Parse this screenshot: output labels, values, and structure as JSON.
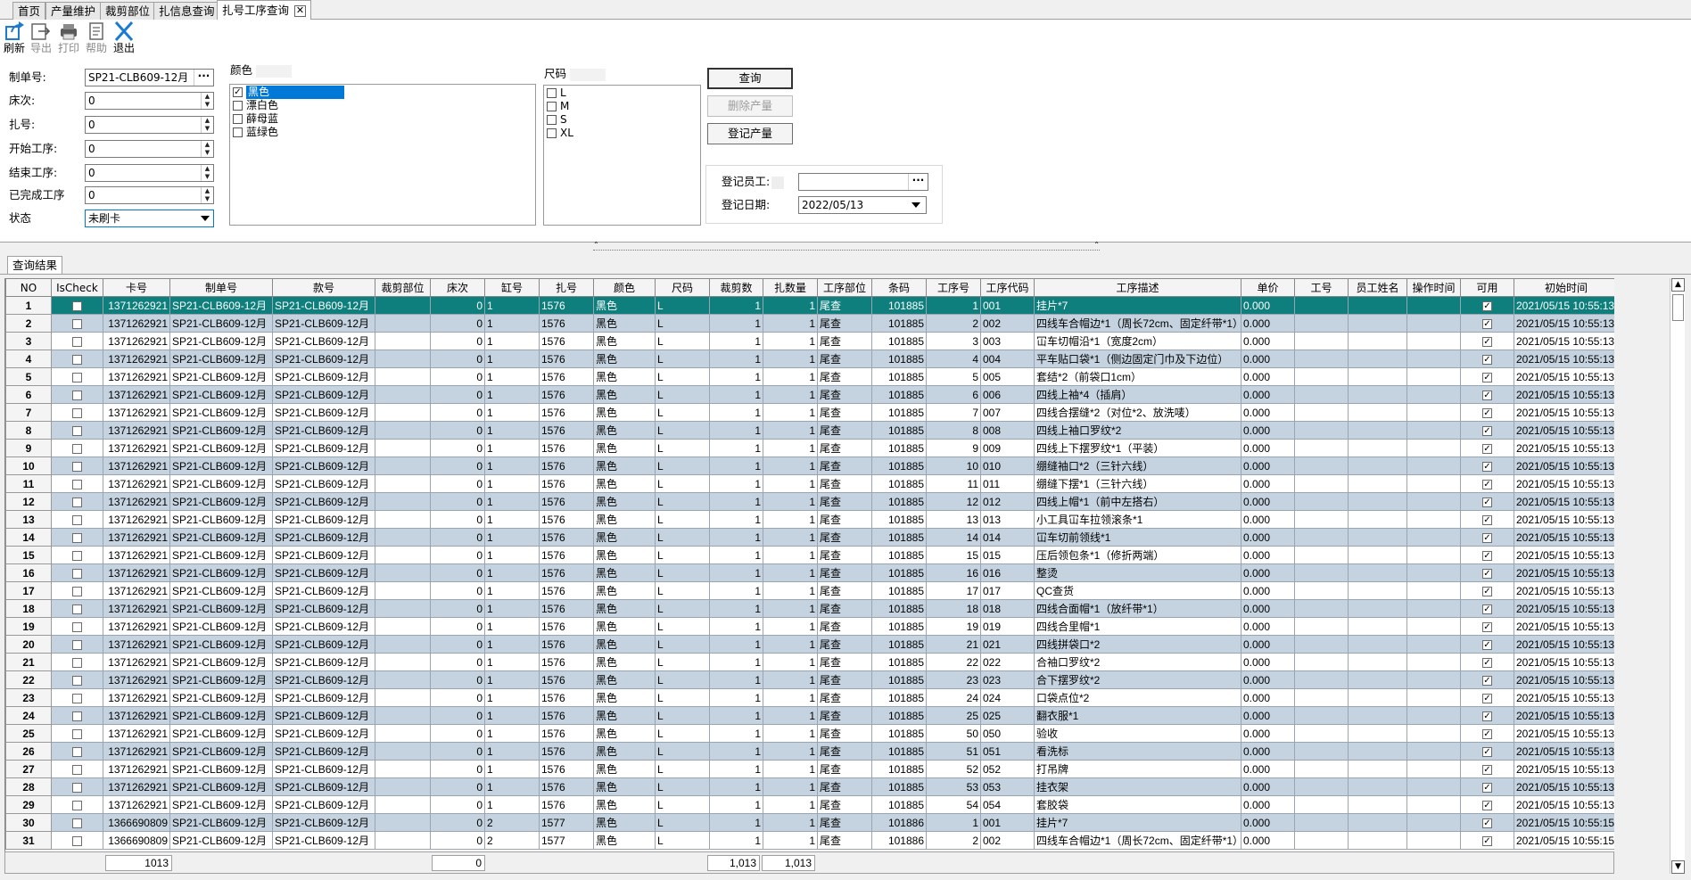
{
  "tabs": [
    {
      "label": "首页",
      "active": false
    },
    {
      "label": "产量维护",
      "active": false
    },
    {
      "label": "裁剪部位",
      "active": false
    },
    {
      "label": "扎信息查询",
      "active": false
    },
    {
      "label": "扎号工序查询",
      "active": true
    }
  ],
  "toolbar": {
    "refresh": "刷新",
    "export": "导出",
    "print": "打印",
    "help": "帮助",
    "exit": "退出"
  },
  "filters": {
    "order_label": "制单号:",
    "order_value": "SP21-CLB609-12月",
    "bed_label": "床次:",
    "bed_value": "0",
    "bundle_label": "扎号:",
    "bundle_value": "0",
    "start_label": "开始工序:",
    "start_value": "0",
    "end_label": "结束工序:",
    "end_value": "0",
    "done_label": "已完成工序",
    "done_value": "0",
    "status_label": "状态",
    "status_value": "未刷卡"
  },
  "color": {
    "label": "颜色",
    "items": [
      {
        "name": "黑色",
        "checked": true,
        "selected": true
      },
      {
        "name": "漂白色",
        "checked": false,
        "selected": false
      },
      {
        "name": "薛母蓝",
        "checked": false,
        "selected": false
      },
      {
        "name": "蓝绿色",
        "checked": false,
        "selected": false
      }
    ]
  },
  "size": {
    "label": "尺码",
    "items": [
      {
        "name": "L",
        "checked": false
      },
      {
        "name": "M",
        "checked": false
      },
      {
        "name": "S",
        "checked": false
      },
      {
        "name": "XL",
        "checked": false
      }
    ]
  },
  "buttons": {
    "query": "查询",
    "delete_output": "删除产量",
    "register_output": "登记产量"
  },
  "register": {
    "employee_label": "登记员工:",
    "employee_value": "",
    "date_label": "登记日期:",
    "date_value": "2022/05/13"
  },
  "result_tab": "查询结果",
  "grid": {
    "columns": [
      "NO",
      "IsCheck",
      "卡号",
      "制单号",
      "款号",
      "裁剪部位",
      "床次",
      "缸号",
      "扎号",
      "颜色",
      "尺码",
      "裁剪数",
      "扎数量",
      "工序部位",
      "条码",
      "工序号",
      "工序代码",
      "工序描述",
      "单价",
      "工号",
      "员工姓名",
      "操作时间",
      "可用",
      "初始时间"
    ],
    "rows": [
      [
        "1",
        "",
        "1371262921",
        "SP21-CLB609-12月",
        "SP21-CLB609-12月",
        "",
        "0",
        "1",
        "1576",
        "黑色",
        "L",
        "1",
        "1",
        "尾查",
        "101885",
        "1",
        "001",
        "挂片*7",
        "0.000",
        "",
        "",
        "",
        "✓",
        "2021/05/15 10:55:13"
      ],
      [
        "2",
        "",
        "1371262921",
        "SP21-CLB609-12月",
        "SP21-CLB609-12月",
        "",
        "0",
        "1",
        "1576",
        "黑色",
        "L",
        "1",
        "1",
        "尾查",
        "101885",
        "2",
        "002",
        "四线车合帽边*1（周长72cm、固定纤带*1）",
        "0.000",
        "",
        "",
        "",
        "✓",
        "2021/05/15 10:55:13"
      ],
      [
        "3",
        "",
        "1371262921",
        "SP21-CLB609-12月",
        "SP21-CLB609-12月",
        "",
        "0",
        "1",
        "1576",
        "黑色",
        "L",
        "1",
        "1",
        "尾查",
        "101885",
        "3",
        "003",
        "冚车切帽沿*1（宽度2cm）",
        "0.000",
        "",
        "",
        "",
        "✓",
        "2021/05/15 10:55:13"
      ],
      [
        "4",
        "",
        "1371262921",
        "SP21-CLB609-12月",
        "SP21-CLB609-12月",
        "",
        "0",
        "1",
        "1576",
        "黑色",
        "L",
        "1",
        "1",
        "尾查",
        "101885",
        "4",
        "004",
        "平车贴口袋*1（侧边固定门巾及下边位）",
        "0.000",
        "",
        "",
        "",
        "✓",
        "2021/05/15 10:55:13"
      ],
      [
        "5",
        "",
        "1371262921",
        "SP21-CLB609-12月",
        "SP21-CLB609-12月",
        "",
        "0",
        "1",
        "1576",
        "黑色",
        "L",
        "1",
        "1",
        "尾查",
        "101885",
        "5",
        "005",
        "套结*2（前袋口1cm）",
        "0.000",
        "",
        "",
        "",
        "✓",
        "2021/05/15 10:55:13"
      ],
      [
        "6",
        "",
        "1371262921",
        "SP21-CLB609-12月",
        "SP21-CLB609-12月",
        "",
        "0",
        "1",
        "1576",
        "黑色",
        "L",
        "1",
        "1",
        "尾查",
        "101885",
        "6",
        "006",
        "四线上袖*4（插肩）",
        "0.000",
        "",
        "",
        "",
        "✓",
        "2021/05/15 10:55:13"
      ],
      [
        "7",
        "",
        "1371262921",
        "SP21-CLB609-12月",
        "SP21-CLB609-12月",
        "",
        "0",
        "1",
        "1576",
        "黑色",
        "L",
        "1",
        "1",
        "尾查",
        "101885",
        "7",
        "007",
        "四线合摆缝*2（对位*2、放洗唛）",
        "0.000",
        "",
        "",
        "",
        "✓",
        "2021/05/15 10:55:13"
      ],
      [
        "8",
        "",
        "1371262921",
        "SP21-CLB609-12月",
        "SP21-CLB609-12月",
        "",
        "0",
        "1",
        "1576",
        "黑色",
        "L",
        "1",
        "1",
        "尾查",
        "101885",
        "8",
        "008",
        "四线上袖口罗纹*2",
        "0.000",
        "",
        "",
        "",
        "✓",
        "2021/05/15 10:55:13"
      ],
      [
        "9",
        "",
        "1371262921",
        "SP21-CLB609-12月",
        "SP21-CLB609-12月",
        "",
        "0",
        "1",
        "1576",
        "黑色",
        "L",
        "1",
        "1",
        "尾查",
        "101885",
        "9",
        "009",
        "四线上下摆罗纹*1（平装）",
        "0.000",
        "",
        "",
        "",
        "✓",
        "2021/05/15 10:55:13"
      ],
      [
        "10",
        "",
        "1371262921",
        "SP21-CLB609-12月",
        "SP21-CLB609-12月",
        "",
        "0",
        "1",
        "1576",
        "黑色",
        "L",
        "1",
        "1",
        "尾查",
        "101885",
        "10",
        "010",
        "绷缝袖口*2（三针六线）",
        "0.000",
        "",
        "",
        "",
        "✓",
        "2021/05/15 10:55:13"
      ],
      [
        "11",
        "",
        "1371262921",
        "SP21-CLB609-12月",
        "SP21-CLB609-12月",
        "",
        "0",
        "1",
        "1576",
        "黑色",
        "L",
        "1",
        "1",
        "尾查",
        "101885",
        "11",
        "011",
        "绷缝下摆*1（三针六线）",
        "0.000",
        "",
        "",
        "",
        "✓",
        "2021/05/15 10:55:13"
      ],
      [
        "12",
        "",
        "1371262921",
        "SP21-CLB609-12月",
        "SP21-CLB609-12月",
        "",
        "0",
        "1",
        "1576",
        "黑色",
        "L",
        "1",
        "1",
        "尾查",
        "101885",
        "12",
        "012",
        "四线上帽*1（前中左搭右）",
        "0.000",
        "",
        "",
        "",
        "✓",
        "2021/05/15 10:55:13"
      ],
      [
        "13",
        "",
        "1371262921",
        "SP21-CLB609-12月",
        "SP21-CLB609-12月",
        "",
        "0",
        "1",
        "1576",
        "黑色",
        "L",
        "1",
        "1",
        "尾查",
        "101885",
        "13",
        "013",
        "小工具冚车拉领滚条*1",
        "0.000",
        "",
        "",
        "",
        "✓",
        "2021/05/15 10:55:13"
      ],
      [
        "14",
        "",
        "1371262921",
        "SP21-CLB609-12月",
        "SP21-CLB609-12月",
        "",
        "0",
        "1",
        "1576",
        "黑色",
        "L",
        "1",
        "1",
        "尾查",
        "101885",
        "14",
        "014",
        "冚车切前领线*1",
        "0.000",
        "",
        "",
        "",
        "✓",
        "2021/05/15 10:55:13"
      ],
      [
        "15",
        "",
        "1371262921",
        "SP21-CLB609-12月",
        "SP21-CLB609-12月",
        "",
        "0",
        "1",
        "1576",
        "黑色",
        "L",
        "1",
        "1",
        "尾查",
        "101885",
        "15",
        "015",
        "压后领包条*1（修折两端）",
        "0.000",
        "",
        "",
        "",
        "✓",
        "2021/05/15 10:55:13"
      ],
      [
        "16",
        "",
        "1371262921",
        "SP21-CLB609-12月",
        "SP21-CLB609-12月",
        "",
        "0",
        "1",
        "1576",
        "黑色",
        "L",
        "1",
        "1",
        "尾查",
        "101885",
        "16",
        "016",
        "整烫",
        "0.000",
        "",
        "",
        "",
        "✓",
        "2021/05/15 10:55:13"
      ],
      [
        "17",
        "",
        "1371262921",
        "SP21-CLB609-12月",
        "SP21-CLB609-12月",
        "",
        "0",
        "1",
        "1576",
        "黑色",
        "L",
        "1",
        "1",
        "尾查",
        "101885",
        "17",
        "017",
        "QC查货",
        "0.000",
        "",
        "",
        "",
        "✓",
        "2021/05/15 10:55:13"
      ],
      [
        "18",
        "",
        "1371262921",
        "SP21-CLB609-12月",
        "SP21-CLB609-12月",
        "",
        "0",
        "1",
        "1576",
        "黑色",
        "L",
        "1",
        "1",
        "尾查",
        "101885",
        "18",
        "018",
        "四线合面帽*1（放纤带*1）",
        "0.000",
        "",
        "",
        "",
        "✓",
        "2021/05/15 10:55:13"
      ],
      [
        "19",
        "",
        "1371262921",
        "SP21-CLB609-12月",
        "SP21-CLB609-12月",
        "",
        "0",
        "1",
        "1576",
        "黑色",
        "L",
        "1",
        "1",
        "尾查",
        "101885",
        "19",
        "019",
        "四线合里帽*1",
        "0.000",
        "",
        "",
        "",
        "✓",
        "2021/05/15 10:55:13"
      ],
      [
        "20",
        "",
        "1371262921",
        "SP21-CLB609-12月",
        "SP21-CLB609-12月",
        "",
        "0",
        "1",
        "1576",
        "黑色",
        "L",
        "1",
        "1",
        "尾查",
        "101885",
        "21",
        "021",
        "四线拼袋口*2",
        "0.000",
        "",
        "",
        "",
        "✓",
        "2021/05/15 10:55:13"
      ],
      [
        "21",
        "",
        "1371262921",
        "SP21-CLB609-12月",
        "SP21-CLB609-12月",
        "",
        "0",
        "1",
        "1576",
        "黑色",
        "L",
        "1",
        "1",
        "尾查",
        "101885",
        "22",
        "022",
        "合袖口罗纹*2",
        "0.000",
        "",
        "",
        "",
        "✓",
        "2021/05/15 10:55:13"
      ],
      [
        "22",
        "",
        "1371262921",
        "SP21-CLB609-12月",
        "SP21-CLB609-12月",
        "",
        "0",
        "1",
        "1576",
        "黑色",
        "L",
        "1",
        "1",
        "尾查",
        "101885",
        "23",
        "023",
        "合下摆罗纹*2",
        "0.000",
        "",
        "",
        "",
        "✓",
        "2021/05/15 10:55:13"
      ],
      [
        "23",
        "",
        "1371262921",
        "SP21-CLB609-12月",
        "SP21-CLB609-12月",
        "",
        "0",
        "1",
        "1576",
        "黑色",
        "L",
        "1",
        "1",
        "尾查",
        "101885",
        "24",
        "024",
        "口袋点位*2",
        "0.000",
        "",
        "",
        "",
        "✓",
        "2021/05/15 10:55:13"
      ],
      [
        "24",
        "",
        "1371262921",
        "SP21-CLB609-12月",
        "SP21-CLB609-12月",
        "",
        "0",
        "1",
        "1576",
        "黑色",
        "L",
        "1",
        "1",
        "尾查",
        "101885",
        "25",
        "025",
        "翻衣服*1",
        "0.000",
        "",
        "",
        "",
        "✓",
        "2021/05/15 10:55:13"
      ],
      [
        "25",
        "",
        "1371262921",
        "SP21-CLB609-12月",
        "SP21-CLB609-12月",
        "",
        "0",
        "1",
        "1576",
        "黑色",
        "L",
        "1",
        "1",
        "尾查",
        "101885",
        "50",
        "050",
        "验收",
        "0.000",
        "",
        "",
        "",
        "✓",
        "2021/05/15 10:55:13"
      ],
      [
        "26",
        "",
        "1371262921",
        "SP21-CLB609-12月",
        "SP21-CLB609-12月",
        "",
        "0",
        "1",
        "1576",
        "黑色",
        "L",
        "1",
        "1",
        "尾查",
        "101885",
        "51",
        "051",
        "看洗标",
        "0.000",
        "",
        "",
        "",
        "✓",
        "2021/05/15 10:55:13"
      ],
      [
        "27",
        "",
        "1371262921",
        "SP21-CLB609-12月",
        "SP21-CLB609-12月",
        "",
        "0",
        "1",
        "1576",
        "黑色",
        "L",
        "1",
        "1",
        "尾查",
        "101885",
        "52",
        "052",
        "打吊牌",
        "0.000",
        "",
        "",
        "",
        "✓",
        "2021/05/15 10:55:13"
      ],
      [
        "28",
        "",
        "1371262921",
        "SP21-CLB609-12月",
        "SP21-CLB609-12月",
        "",
        "0",
        "1",
        "1576",
        "黑色",
        "L",
        "1",
        "1",
        "尾查",
        "101885",
        "53",
        "053",
        "挂衣架",
        "0.000",
        "",
        "",
        "",
        "✓",
        "2021/05/15 10:55:13"
      ],
      [
        "29",
        "",
        "1371262921",
        "SP21-CLB609-12月",
        "SP21-CLB609-12月",
        "",
        "0",
        "1",
        "1576",
        "黑色",
        "L",
        "1",
        "1",
        "尾查",
        "101885",
        "54",
        "054",
        "套胶袋",
        "0.000",
        "",
        "",
        "",
        "✓",
        "2021/05/15 10:55:13"
      ],
      [
        "30",
        "",
        "1366690809",
        "SP21-CLB609-12月",
        "SP21-CLB609-12月",
        "",
        "0",
        "2",
        "1577",
        "黑色",
        "L",
        "1",
        "1",
        "尾查",
        "101886",
        "1",
        "001",
        "挂片*7",
        "0.000",
        "",
        "",
        "",
        "✓",
        "2021/05/15 10:55:15"
      ],
      [
        "31",
        "",
        "1366690809",
        "SP21-CLB609-12月",
        "SP21-CLB609-12月",
        "",
        "0",
        "2",
        "1577",
        "黑色",
        "L",
        "1",
        "1",
        "尾查",
        "101886",
        "2",
        "002",
        "四线车合帽边*1（周长72cm、固定纤带*1）",
        "0.000",
        "",
        "",
        "",
        "✓",
        "2021/05/15 10:55:15"
      ]
    ]
  },
  "footer": {
    "card_count": "1013",
    "bed_sum": "0",
    "cut_sum": "1,013",
    "bundle_sum": "1,013"
  }
}
